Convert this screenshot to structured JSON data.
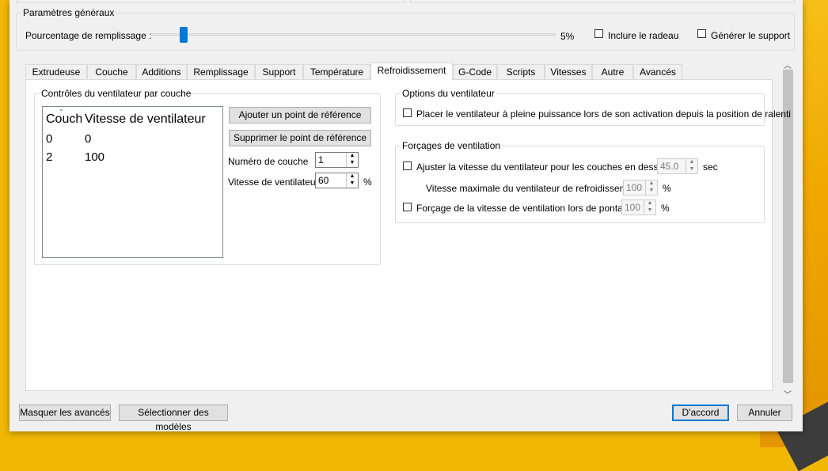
{
  "general": {
    "title": "Paramètres généraux",
    "fill_label": "Pourcentage de remplissage :",
    "fill_value_text": "5%",
    "fill_fraction": 0.05,
    "include_raft_label": "Inclure le radeau",
    "include_raft_checked": false,
    "generate_support_label": "Générer le support",
    "generate_support_checked": false
  },
  "tabs": [
    "Extrudeuse",
    "Couche",
    "Additions",
    "Remplissage",
    "Support",
    "Température",
    "Refroidissement",
    "G-Code",
    "Scripts",
    "Vitesses",
    "Autre",
    "Avancés"
  ],
  "active_tab": "Refroidissement",
  "fan_controls": {
    "title": "Contrôles du ventilateur par couche",
    "columns": [
      "Couch",
      "Vitesse de ventilateur"
    ],
    "rows": [
      [
        "0",
        "0"
      ],
      [
        "2",
        "100"
      ]
    ],
    "add_button": "Ajouter un point de référence",
    "remove_button": "Supprimer le point de référence",
    "layer_label": "Numéro de couche",
    "layer_value": "1",
    "speed_label": "Vitesse de ventilateur",
    "speed_value": "60",
    "speed_unit": "%"
  },
  "fan_options": {
    "title": "Options du ventilateur",
    "full_power_label": "Placer le ventilateur à pleine puissance lors de son activation depuis la position de ralenti",
    "full_power_checked": false
  },
  "overrides": {
    "title": "Forçages de ventilation",
    "adjust_label": "Ajuster la vitesse du ventilateur pour les couches en dessous",
    "adjust_checked": false,
    "adjust_value": "45.0",
    "adjust_unit": "sec",
    "max_speed_label": "Vitesse maximale du ventilateur de refroidissement",
    "max_speed_value": "100",
    "max_speed_unit": "%",
    "bridge_label": "Forçage de la vitesse de ventilation lors de pontage",
    "bridge_checked": false,
    "bridge_value": "100",
    "bridge_unit": "%"
  },
  "footer": {
    "hide_advanced": "Masquer les avancés",
    "select_models": "Sélectionner des modèles",
    "ok": "D'accord",
    "cancel": "Annuler"
  },
  "colors": {
    "accent": "#0078d7",
    "background": "#f2b705"
  }
}
